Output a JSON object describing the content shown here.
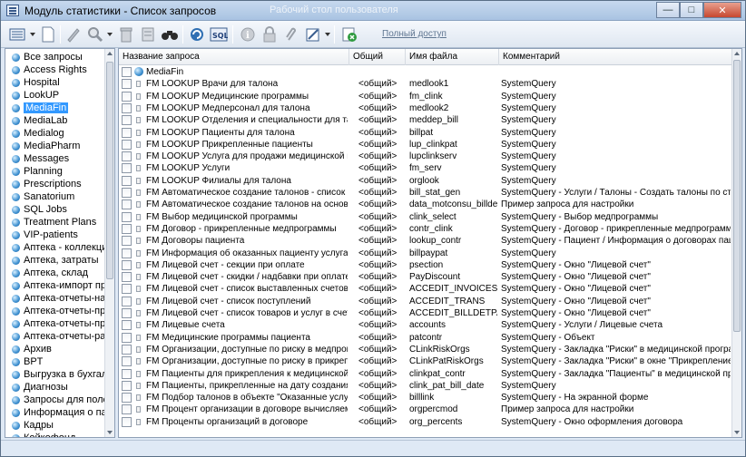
{
  "window": {
    "title": "Модуль статистики - Список запросов",
    "ghost_title": "Рабочий стол пользователя"
  },
  "toolbar": {
    "full_access_label": "Полный доступ",
    "icons": [
      "list-view-icon",
      "new-doc-icon",
      "edit-icon",
      "search-icon",
      "delete-icon",
      "binoculars-icon",
      "refresh-icon",
      "sql-icon",
      "info-icon",
      "lock-icon",
      "attach-icon",
      "export-icon",
      "exit-icon"
    ]
  },
  "sidebar": {
    "items": [
      {
        "label": "Все запросы"
      },
      {
        "label": "Access Rights"
      },
      {
        "label": "Hospital"
      },
      {
        "label": "LookUP"
      },
      {
        "label": "MediaFin",
        "selected": true
      },
      {
        "label": "MediaLab"
      },
      {
        "label": "Medialog"
      },
      {
        "label": "MediaPharm"
      },
      {
        "label": "Messages"
      },
      {
        "label": "Planning"
      },
      {
        "label": "Prescriptions"
      },
      {
        "label": "Sanatorium"
      },
      {
        "label": "SQL Jobs"
      },
      {
        "label": "Treatment Plans"
      },
      {
        "label": "VIP-patients"
      },
      {
        "label": "Аптека - коллекция"
      },
      {
        "label": "Аптека, затраты"
      },
      {
        "label": "Аптека, склад"
      },
      {
        "label": "Аптека-импорт прихо..."
      },
      {
        "label": "Аптека-отчеты-нали..."
      },
      {
        "label": "Аптека-отчеты-прихо..."
      },
      {
        "label": "Аптека-отчеты-прихо..."
      },
      {
        "label": "Аптека-отчеты-расхо..."
      },
      {
        "label": "Архив"
      },
      {
        "label": "BPT"
      },
      {
        "label": "Выгрузка в бухгалтер..."
      },
      {
        "label": "Диагнозы"
      },
      {
        "label": "Запросы для полей \"с..."
      },
      {
        "label": "Информация о пациен..."
      },
      {
        "label": "Кадры"
      },
      {
        "label": "Койкофонд"
      }
    ]
  },
  "grid": {
    "columns": {
      "name": "Название запроса",
      "shared": "Общий",
      "file": "Имя файла",
      "comment": "Комментарий"
    },
    "root_label": "MediaFin",
    "rows": [
      {
        "name": "FM LOOKUP Врачи для талона",
        "shared": "<общий>",
        "file": "medlook1",
        "comment": "SystemQuery"
      },
      {
        "name": "FM LOOKUP Медицинские программы",
        "shared": "<общий>",
        "file": "fm_clink",
        "comment": "SystemQuery"
      },
      {
        "name": "FM LOOKUP Медперсонал для талона",
        "shared": "<общий>",
        "file": "medlook2",
        "comment": "SystemQuery"
      },
      {
        "name": "FM LOOKUP Отделения и специальности для талона",
        "shared": "<общий>",
        "file": "meddep_bill",
        "comment": "SystemQuery"
      },
      {
        "name": "FM LOOKUP Пациенты для талона",
        "shared": "<общий>",
        "file": "billpat",
        "comment": "SystemQuery"
      },
      {
        "name": "FM LOOKUP Прикрепленные пациенты",
        "shared": "<общий>",
        "file": "lup_clinkpat",
        "comment": "SystemQuery"
      },
      {
        "name": "FM LOOKUP Услуга для продажи медицинской програ...",
        "shared": "<общий>",
        "file": "lupclinkserv",
        "comment": "SystemQuery"
      },
      {
        "name": "FM LOOKUP Услуги",
        "shared": "<общий>",
        "file": "fm_serv",
        "comment": "SystemQuery"
      },
      {
        "name": "FM LOOKUP Филиалы для талона",
        "shared": "<общий>",
        "file": "orglook",
        "comment": "SystemQuery"
      },
      {
        "name": "FM Автоматическое создание талонов - список запросо...",
        "shared": "<общий>",
        "file": "bill_stat_gen",
        "comment": "SystemQuery - Услуги / Талоны - Создать талоны по стат. за..."
      },
      {
        "name": "FM Автоматическое создание талонов на основе усл...",
        "shared": "<общий>",
        "file": "data_motconsu_billdet",
        "comment": "Пример запроса для настройки"
      },
      {
        "name": "FM Выбор медицинской программы",
        "shared": "<общий>",
        "file": "clink_select",
        "comment": "SystemQuery - Выбор медпрограммы"
      },
      {
        "name": "FM Договор - прикрепленные медпрограммы",
        "shared": "<общий>",
        "file": "contr_clink",
        "comment": "SystemQuery - Договор - прикрепленные медпрограммы"
      },
      {
        "name": "FM Договоры пациента",
        "shared": "<общий>",
        "file": "lookup_contr",
        "comment": "SystemQuery - Пациент / Информация о договорах пациента"
      },
      {
        "name": "FM Информация об оказанных пациенту услугах",
        "shared": "<общий>",
        "file": "billpaypat",
        "comment": "SystemQuery"
      },
      {
        "name": "FM Лицевой счет - секции при оплате",
        "shared": "<общий>",
        "file": "psection",
        "comment": "SystemQuery - Окно \"Лицевой счет\""
      },
      {
        "name": "FM Лицевой счет - скидки / надбавки при оплате",
        "shared": "<общий>",
        "file": "PayDiscount",
        "comment": "SystemQuery - Окно \"Лицевой счет\""
      },
      {
        "name": "FM Лицевой счет - список выставленных счетов",
        "shared": "<общий>",
        "file": "ACCEDIT_INVOICES",
        "comment": "SystemQuery - Окно \"Лицевой счет\""
      },
      {
        "name": "FM Лицевой счет - список поступлений",
        "shared": "<общий>",
        "file": "ACCEDIT_TRANS",
        "comment": "SystemQuery - Окно \"Лицевой счет\""
      },
      {
        "name": "FM Лицевой счет - список товаров и услуг в счете",
        "shared": "<общий>",
        "file": "ACCEDIT_BILLDETPAYS",
        "comment": "SystemQuery - Окно \"Лицевой счет\""
      },
      {
        "name": "FM Лицевые счета",
        "shared": "<общий>",
        "file": "accounts",
        "comment": "SystemQuery - Услуги / Лицевые счета"
      },
      {
        "name": "FM Медицинские программы пациента",
        "shared": "<общий>",
        "file": "patcontr",
        "comment": "SystemQuery - Объект"
      },
      {
        "name": "FM Организации, доступные по риску в медпрограмме",
        "shared": "<общий>",
        "file": "CLinkRiskOrgs",
        "comment": "SystemQuery - Закладка \"Риски\" в медицинской программе"
      },
      {
        "name": "FM Организации, доступные по риску в прикреплени...",
        "shared": "<общий>",
        "file": "CLinkPatRiskOrgs",
        "comment": "SystemQuery - Закладка \"Риски\" в окне \"Прикрепление пацие..."
      },
      {
        "name": "FM Пациенты для прикрепления к медицинской прог...",
        "shared": "<общий>",
        "file": "clinkpat_contr",
        "comment": "SystemQuery - Закладка \"Пациенты\" в медицинской программе"
      },
      {
        "name": "FM Пациенты, прикрепленные на дату создания тал...",
        "shared": "<общий>",
        "file": "clink_pat_bill_date",
        "comment": "SystemQuery"
      },
      {
        "name": "FM Подбор талонов в объекте \"Оказанные услуги\"",
        "shared": "<общий>",
        "file": "billlink",
        "comment": "SystemQuery - На экранной форме"
      },
      {
        "name": "FM Процент организации в договоре вычисляемый",
        "shared": "<общий>",
        "file": "orgpercmod",
        "comment": "Пример запроса для настройки"
      },
      {
        "name": "FM Проценты организаций в договоре",
        "shared": "<общий>",
        "file": "org_percents",
        "comment": "SystemQuery - Окно оформления договора"
      }
    ]
  }
}
